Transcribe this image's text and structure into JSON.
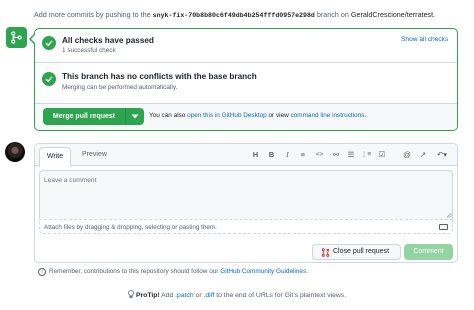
{
  "header": {
    "text_before": "Add more commits by pushing to the ",
    "branch": "snyk-fix-70b8b80c6f49db4b254fffd0957e298d",
    "text_middle": " branch on ",
    "repo": "GeraldCrescione/terratest",
    "text_after": "."
  },
  "merge_status": {
    "checks": {
      "title": "All checks have passed",
      "subtitle": "1 successful check",
      "link": "Show all checks"
    },
    "conflicts": {
      "title": "This branch has no conflicts with the base branch",
      "subtitle": "Merging can be performed automatically."
    },
    "merge_button": "Merge pull request",
    "hint_prefix": "You can also ",
    "hint_link1": "open this in GitHub Desktop",
    "hint_middle": " or view ",
    "hint_link2": "command line instructions",
    "hint_suffix": "."
  },
  "editor": {
    "tabs": [
      "Write",
      "Preview"
    ],
    "placeholder": "Leave a comment",
    "attach_text": "Attach files by dragging & dropping, selecting or pasting them.",
    "toolbar": [
      {
        "icon": "heading-icon",
        "glyph": "H"
      },
      {
        "icon": "bold-icon",
        "glyph": "B"
      },
      {
        "icon": "italic-icon",
        "glyph": "I"
      },
      {
        "icon": "quote-icon",
        "glyph": "≡"
      },
      {
        "icon": "code-icon",
        "glyph": "<>"
      },
      {
        "icon": "link-icon",
        "glyph": "⚯"
      },
      {
        "icon": "unordered-list-icon",
        "glyph": "☰"
      },
      {
        "icon": "ordered-list-icon",
        "glyph": "⋮≡"
      },
      {
        "icon": "task-list-icon",
        "glyph": "☑"
      },
      {
        "icon": "mention-icon",
        "glyph": "@"
      },
      {
        "icon": "reference-icon",
        "glyph": "↗"
      },
      {
        "icon": "undo-icon",
        "glyph": "↶▾"
      }
    ]
  },
  "actions": {
    "close": "Close pull request",
    "comment": "Comment"
  },
  "footer": {
    "remember_prefix": "Remember, contributions to this repository should follow our ",
    "remember_link": "GitHub Community Guidelines",
    "remember_suffix": ".",
    "protip_label": "ProTip!",
    "protip_text1": " Add ",
    "protip_patch": ".patch",
    "protip_or": " or ",
    "protip_diff": ".diff",
    "protip_text2": " to the end of URLs for Git’s plaintext views."
  },
  "colors": {
    "success": "#2da44e",
    "link": "#0969da",
    "comment_disabled": "#94d3a2",
    "danger": "#cf222e"
  }
}
